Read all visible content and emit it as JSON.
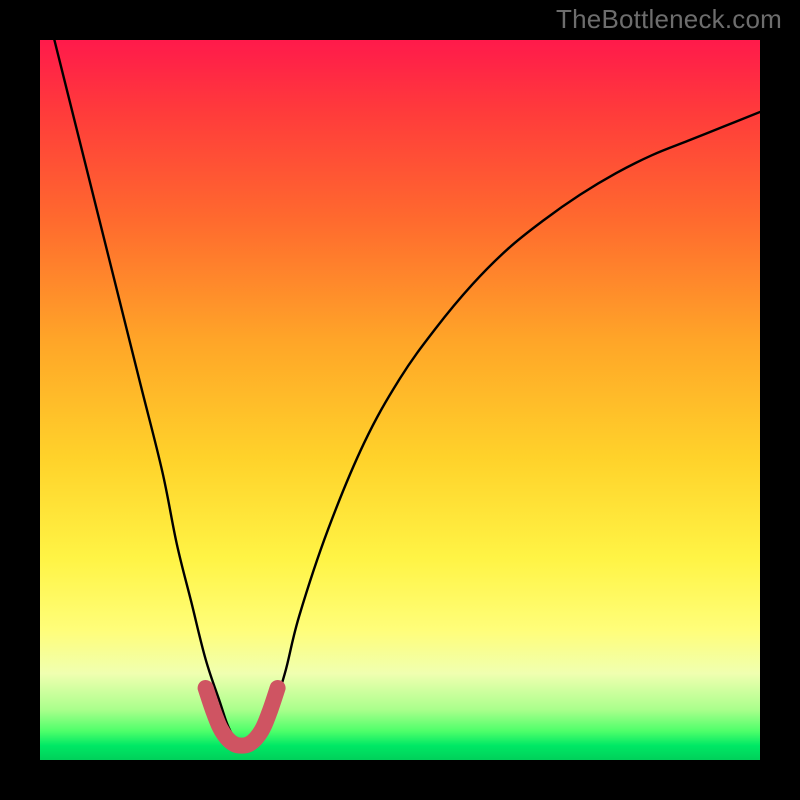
{
  "watermark": "TheBottleneck.com",
  "chart_data": {
    "type": "line",
    "title": "",
    "xlabel": "",
    "ylabel": "",
    "xlim": [
      0,
      100
    ],
    "ylim": [
      0,
      100
    ],
    "series": [
      {
        "name": "bottleneck-curve",
        "x": [
          2,
          5,
          8,
          11,
          14,
          17,
          19,
          21,
          23,
          25,
          26,
          27,
          28,
          29,
          30,
          32,
          34,
          36,
          40,
          45,
          50,
          55,
          60,
          65,
          70,
          75,
          80,
          85,
          90,
          95,
          100
        ],
        "values": [
          100,
          88,
          76,
          64,
          52,
          40,
          30,
          22,
          14,
          8,
          5,
          3,
          2,
          2,
          3,
          6,
          12,
          20,
          32,
          44,
          53,
          60,
          66,
          71,
          75,
          78.5,
          81.5,
          84,
          86,
          88,
          90
        ]
      },
      {
        "name": "highlight-segment",
        "x": [
          23,
          24,
          25,
          26,
          27,
          28,
          29,
          30,
          31,
          32,
          33
        ],
        "values": [
          10,
          7,
          4.5,
          3,
          2.2,
          2,
          2.2,
          3,
          4.5,
          7,
          10
        ]
      }
    ],
    "colors": {
      "curve": "#000000",
      "highlight": "#cf5462",
      "gradient_top": "#ff1a4b",
      "gradient_bottom": "#00d05a"
    }
  }
}
